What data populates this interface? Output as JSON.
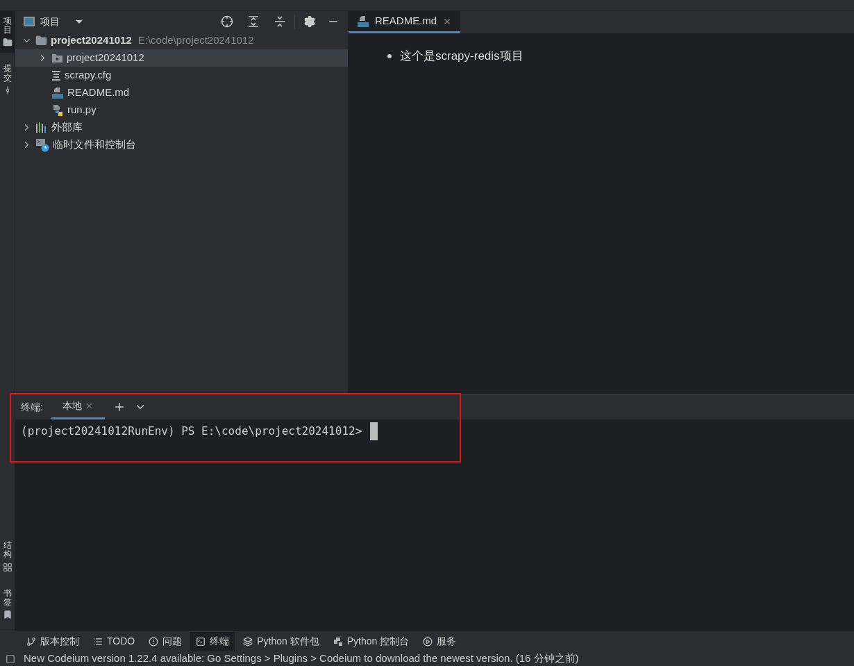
{
  "side_tabs_top": [
    {
      "label": "项目",
      "kind": "folder",
      "selected": true
    },
    {
      "label": "提交",
      "kind": "commit",
      "selected": false
    }
  ],
  "side_tabs_bottom": [
    {
      "label": "结构",
      "kind": "structure",
      "selected": false
    },
    {
      "label": "书签",
      "kind": "bookmark",
      "selected": false
    }
  ],
  "project_panel": {
    "title": "项目"
  },
  "tree": [
    {
      "name": "project20241012",
      "path": "E:\\code\\project20241012",
      "kind": "root",
      "expanded": true,
      "selected": false,
      "children": [
        {
          "name": "project20241012",
          "kind": "package",
          "expanded": false,
          "selected": true
        },
        {
          "name": "scrapy.cfg",
          "kind": "cfg",
          "selected": false
        },
        {
          "name": "README.md",
          "kind": "md",
          "selected": false
        },
        {
          "name": "run.py",
          "kind": "py",
          "selected": false
        }
      ]
    },
    {
      "name": "外部库",
      "kind": "lib",
      "expanded": false,
      "selected": false
    },
    {
      "name": "临时文件和控制台",
      "kind": "scratch",
      "expanded": false,
      "selected": false
    }
  ],
  "editor": {
    "tabs": [
      {
        "label": "README.md",
        "selected": true
      }
    ],
    "bullets": [
      "这个是scrapy-redis项目"
    ]
  },
  "terminal": {
    "label": "终端:",
    "tabs": [
      {
        "label": "本地",
        "selected": true
      }
    ],
    "prompt": "(project20241012RunEnv) PS E:\\code\\project20241012>"
  },
  "tool_windows": [
    {
      "label": "版本控制",
      "kind": "branch",
      "selected": false
    },
    {
      "label": "TODO",
      "kind": "list",
      "selected": false
    },
    {
      "label": "问题",
      "kind": "alert",
      "selected": false
    },
    {
      "label": "终端",
      "kind": "terminal",
      "selected": true
    },
    {
      "label": "Python 软件包",
      "kind": "layers",
      "selected": false
    },
    {
      "label": "Python 控制台",
      "kind": "python",
      "selected": false
    },
    {
      "label": "服务",
      "kind": "play",
      "selected": false
    }
  ],
  "status_bar": {
    "message": "New Codeium version 1.22.4 available: Go Settings > Plugins > Codeium to download the newest version. (16 分钟之前)"
  }
}
